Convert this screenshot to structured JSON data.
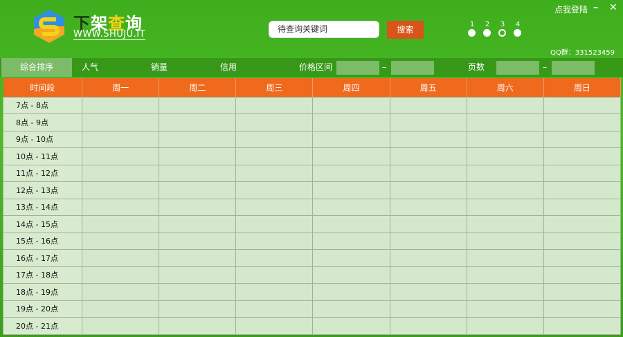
{
  "header": {
    "brand": [
      "下",
      "架",
      "查",
      "询"
    ],
    "url": "WWW.SHUJU.IT",
    "search_placeholder": "待查询关键词",
    "search_button": "搜索",
    "steps": [
      "1",
      "2",
      "3",
      "4"
    ],
    "active_step": 3,
    "login": "点我登陆",
    "minimize": "–",
    "close": "✕",
    "qq": "QQ群：331523459"
  },
  "nav": {
    "tabs": [
      "综合排序",
      "人气",
      "销量",
      "信用"
    ],
    "price_label": "价格区间",
    "page_label": "页数",
    "dash": "–"
  },
  "table": {
    "headers": [
      "时间段",
      "周一",
      "周二",
      "周三",
      "周四",
      "周五",
      "周六",
      "周日"
    ],
    "rows": [
      "7点 - 8点",
      "8点 - 9点",
      "9点 - 10点",
      "10点 - 11点",
      "11点 - 12点",
      "12点 - 13点",
      "13点 - 14点",
      "14点 - 15点",
      "15点 - 16点",
      "16点 - 17点",
      "17点 - 18点",
      "18点 - 19点",
      "19点 - 20点",
      "20点 - 21点"
    ]
  }
}
